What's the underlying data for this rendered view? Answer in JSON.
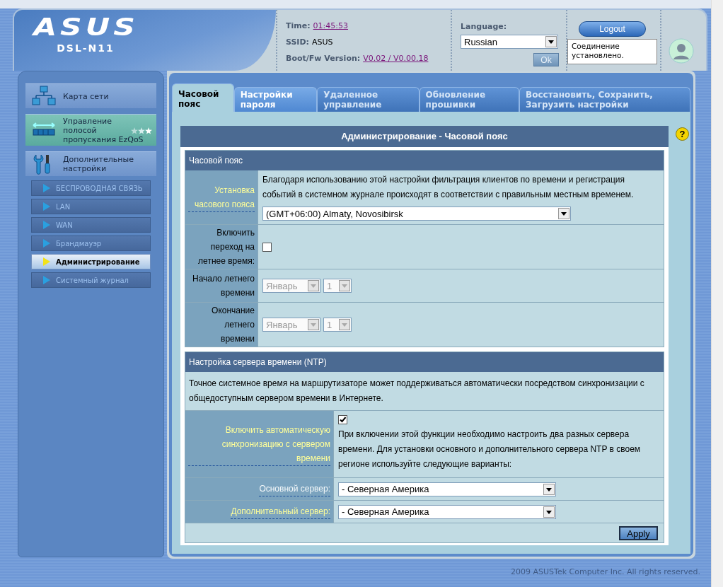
{
  "header": {
    "logo": "ASUS",
    "model": "DSL-N11",
    "info": [
      {
        "label": "Time:",
        "value": "01:45:53",
        "link": true
      },
      {
        "label": "SSID:",
        "value": "ASUS",
        "link": false
      },
      {
        "label": "Boot/Fw Version:",
        "value": "V0.02 / V0.00.18",
        "link": true
      }
    ],
    "language_label": "Language:",
    "language": "Russian",
    "ok_button": "Ok",
    "logout_button": "Logout",
    "status": "Соединение установлено."
  },
  "sidebar": {
    "items": [
      {
        "kind": "network",
        "label": "Карта сети"
      },
      {
        "kind": "qos",
        "label": "Управление полосой пропускания EzQoS"
      },
      {
        "kind": "tools",
        "label": "Дополнительные настройки"
      }
    ],
    "sub_items": [
      {
        "label": "БЕСПРОВОДНАЯ СВЯЗЬ",
        "selected": false
      },
      {
        "label": "LAN",
        "selected": false
      },
      {
        "label": "WAN",
        "selected": false
      },
      {
        "label": "Брандмауэр",
        "selected": false
      },
      {
        "label": "Администрирование",
        "selected": true
      },
      {
        "label": "Системный журнал",
        "selected": false
      }
    ]
  },
  "tabs": [
    {
      "label": "Часовой пояс",
      "selected": true,
      "disabled": false
    },
    {
      "label": "Настройки пароля",
      "selected": false,
      "disabled": false
    },
    {
      "label": "Удаленное управление",
      "selected": false,
      "disabled": true
    },
    {
      "label": "Обновление прошивки",
      "selected": false,
      "disabled": true
    },
    {
      "label": "Восстановить, Сохранить, Загрузить настройки",
      "selected": false,
      "disabled": true
    }
  ],
  "page_title": "Администрирование - Часовой пояс",
  "help": "?",
  "timezone_section": {
    "title": "Часовой пояс",
    "rows": [
      {
        "kind": "select_desc",
        "label": "Установка часового пояса",
        "linked": true,
        "underlined": true,
        "description": "Благодаря использованию этой настройки фильтрация клиентов по времени и регистрация событий в системном журнале происходят в соответствии с правильным местным временем.",
        "value": "(GMT+06:00) Almaty, Novosibirsk"
      },
      {
        "kind": "checkbox",
        "label": "Включить переход на летнее время:",
        "linked": false,
        "underlined": false,
        "checked": false
      },
      {
        "kind": "date",
        "label": "Начало летнего времени",
        "linked": false,
        "underlined": false,
        "month": "Январь",
        "day": "1",
        "disabled": true
      },
      {
        "kind": "date",
        "label": "Окончание летнего времени",
        "linked": false,
        "underlined": false,
        "month": "Январь",
        "day": "1",
        "disabled": true
      }
    ]
  },
  "ntp_section": {
    "title": "Настройка сервера времени (NTP)",
    "description": "Точное системное время на маршрутизаторе может поддерживаться автоматически посредством синхронизации с общедоступным сервером времени в Интернете.",
    "rows": [
      {
        "kind": "checkbox_desc",
        "label": "Включить автоматическую синхронизацию с сервером времени",
        "linked": true,
        "underlined": true,
        "checked": true,
        "description": "При включении этой функции необходимо настроить два разных сервера времени. Для установки основного и дополнительного сервера NTP в своем регионе используйте следующие варианты:"
      },
      {
        "kind": "select",
        "label": "Основной сервер:",
        "linked": false,
        "underlined": true,
        "value": "- Северная Америка"
      },
      {
        "kind": "select",
        "label": "Дополнительный сервер:",
        "linked": true,
        "underlined": true,
        "value": "- Северная Америка"
      }
    ],
    "apply_button": "Apply"
  },
  "footer": "2009 ASUSTek Computer Inc. All rights reserved."
}
